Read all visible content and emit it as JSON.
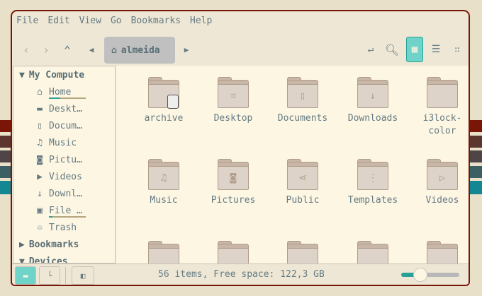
{
  "colors": {
    "accent": "#2aa198",
    "frame": "#7a1608",
    "stripes": [
      "#7a1608",
      "#5c3530",
      "#4f4446",
      "#3b5f62",
      "#138893"
    ]
  },
  "menu": [
    "File",
    "Edit",
    "View",
    "Go",
    "Bookmarks",
    "Help"
  ],
  "toolbar": {
    "location": "almeida",
    "view_mode": "icons"
  },
  "sidebar": {
    "sections": {
      "computer": "My Compute",
      "bookmarks": "Bookmarks",
      "devices": "Devices"
    },
    "items": [
      {
        "label": "Home",
        "icon": "home-icon"
      },
      {
        "label": "Deskt…",
        "icon": "folder-icon"
      },
      {
        "label": "Docum…",
        "icon": "document-icon"
      },
      {
        "label": "Music",
        "icon": "music-icon"
      },
      {
        "label": "Pictu…",
        "icon": "camera-icon"
      },
      {
        "label": "Videos",
        "icon": "video-icon"
      },
      {
        "label": "Downl…",
        "icon": "download-icon"
      },
      {
        "label": "File …",
        "icon": "filesystem-icon"
      },
      {
        "label": "Trash",
        "icon": "trash-icon"
      }
    ],
    "usage": {
      "home": 0.3,
      "filesystem": 0.1
    }
  },
  "files": [
    {
      "name": "archive",
      "emblem": "disk"
    },
    {
      "name": "Desktop",
      "emblem": "desktop"
    },
    {
      "name": "Documents",
      "emblem": "document"
    },
    {
      "name": "Downloads",
      "emblem": "download"
    },
    {
      "name": "i3lock-color",
      "emblem": ""
    },
    {
      "name": "Music",
      "emblem": "music"
    },
    {
      "name": "Pictures",
      "emblem": "camera"
    },
    {
      "name": "Public",
      "emblem": "share"
    },
    {
      "name": "Templates",
      "emblem": "template"
    },
    {
      "name": "Videos",
      "emblem": "video"
    },
    {
      "name": "",
      "emblem": ""
    },
    {
      "name": "",
      "emblem": ""
    },
    {
      "name": "",
      "emblem": ""
    },
    {
      "name": "",
      "emblem": ""
    },
    {
      "name": "",
      "emblem": ""
    }
  ],
  "status": {
    "text": "56 items, Free space: 122,3 GB",
    "zoom": 0.33
  }
}
